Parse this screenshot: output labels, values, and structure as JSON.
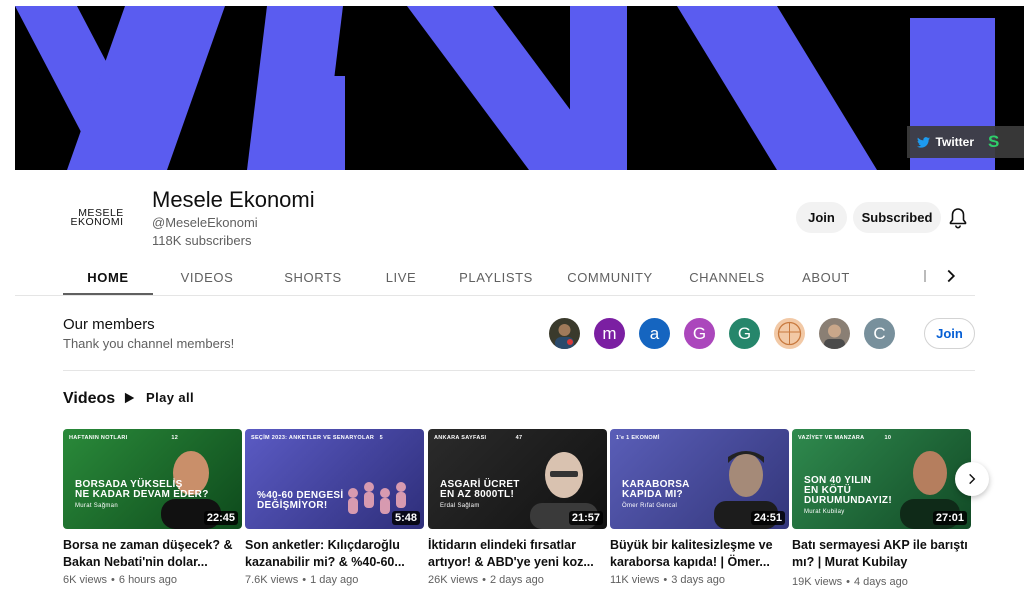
{
  "banner": {
    "links": [
      {
        "label": "Twitter",
        "icon": "twitter-bird-icon"
      },
      {
        "label": "",
        "icon": "substack-icon"
      }
    ],
    "colors": {
      "background": "#000000",
      "stripe": "#5a5cf0"
    }
  },
  "channel": {
    "logo_line1": "MESELE",
    "logo_line2": "EKONOMI",
    "name": "Mesele Ekonomi",
    "handle": "@MeseleEkonomi",
    "subscribers": "118K subscribers",
    "join_label": "Join",
    "subscribed_label": "Subscribed",
    "bell_icon": "bell-icon"
  },
  "tabs": [
    "HOME",
    "VIDEOS",
    "SHORTS",
    "LIVE",
    "PLAYLISTS",
    "COMMUNITY",
    "CHANNELS",
    "ABOUT"
  ],
  "active_tab": "HOME",
  "members": {
    "title": "Our members",
    "subtitle": "Thank you channel members!",
    "avatars": [
      {
        "letter": "",
        "color": "#3a3a2c",
        "type": "photo"
      },
      {
        "letter": "m",
        "color": "#7b1fa2",
        "type": "letter"
      },
      {
        "letter": "a",
        "color": "#1565c0",
        "type": "letter"
      },
      {
        "letter": "G",
        "color": "#ab47bc",
        "type": "letter"
      },
      {
        "letter": "G",
        "color": "#26866b",
        "type": "letter"
      },
      {
        "letter": "",
        "color": "#f2c9a6",
        "type": "photo"
      },
      {
        "letter": "",
        "color": "#8a7f74",
        "type": "photo"
      },
      {
        "letter": "C",
        "color": "#78909c",
        "type": "letter"
      }
    ],
    "join_label": "Join"
  },
  "videos_section": {
    "title": "Videos",
    "play_all": "Play all",
    "items": [
      {
        "tag": "HAFTANIN NOTLARI",
        "tag_num": "12",
        "headline1": "BORSADA YÜKSELİŞ",
        "headline2": "NE KADAR DEVAM EDER?",
        "author": "Murat Sağman",
        "bg": "#1d6b2c",
        "duration": "22:45",
        "title": "Borsa ne zaman düşecek? & Bakan Nebati'nin dolar...",
        "views": "6K views",
        "age": "6 hours ago"
      },
      {
        "tag": "SEÇİM 2023: ANKETLER VE SENARYOLAR",
        "tag_num": "5",
        "headline1": "%40-60 DENGESİ",
        "headline2": "DEĞİŞMİYOR!",
        "author": "",
        "bg": "#4a4aa8",
        "duration": "5:48",
        "title": "Son anketler: Kılıçdaroğlu kazanabilir mi? & %40-60...",
        "views": "7.6K views",
        "age": "1 day ago"
      },
      {
        "tag": "ANKARA SAYFASI",
        "tag_num": "47",
        "headline1": "ASGARİ ÜCRET",
        "headline2": "EN AZ 8000TL!",
        "author": "Erdal Sağlam",
        "bg": "#1e1e1e",
        "duration": "21:57",
        "title": "İktidarın elindeki fırsatlar artıyor! & ABD'ye yeni koz...",
        "views": "26K views",
        "age": "2 days ago"
      },
      {
        "tag": "1'e 1 EKONOMİ",
        "tag_num": "",
        "headline1": "KARABORSA",
        "headline2": "KAPIDA MI?",
        "author": "Ömer Rıfat Gencal",
        "bg": "#4b4fa0",
        "duration": "24:51",
        "title": "Büyük bir kalitesizleşme ve karaborsa kapıda! | Ömer...",
        "views": "11K views",
        "age": "3 days ago"
      },
      {
        "tag": "VAZİYET VE MANZARA",
        "tag_num": "10",
        "headline1": "SON 40 YILIN EN KÖTÜ",
        "headline2": "DURUMUNDAYIZ!",
        "author": "Murat Kubilay",
        "bg": "#1f6b3a",
        "duration": "27:01",
        "title": "Batı sermayesi AKP ile barıştı mı? | Murat Kubilay",
        "views": "19K views",
        "age": "4 days ago"
      }
    ]
  }
}
